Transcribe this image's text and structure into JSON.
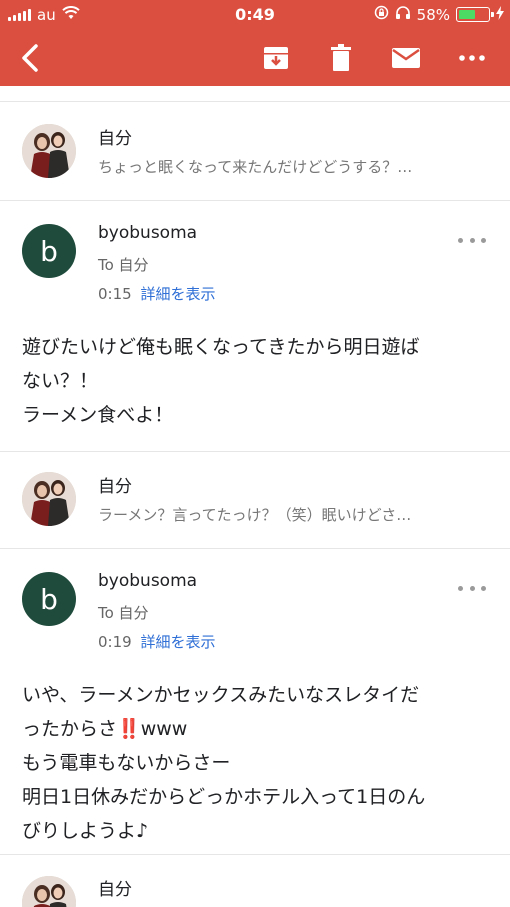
{
  "status": {
    "carrier": "au",
    "time": "0:49",
    "battery_percent_text": "58%",
    "battery_level": 0.58,
    "colors": {
      "battery_fill": "#4cd964"
    }
  },
  "toolbar": {
    "back_icon": "chevron-left-icon",
    "archive_icon": "archive-icon",
    "delete_icon": "trash-icon",
    "mark_unread_icon": "mail-icon",
    "more_icon": "more-horizontal-icon",
    "color": "#db4f40"
  },
  "thread": {
    "messages": [
      {
        "collapsed": true,
        "sender": "自分",
        "snippet": "ちょっと眠くなって来たんだけどどうする？…"
      },
      {
        "collapsed": false,
        "sender": "byobusoma",
        "avatar_letter": "b",
        "to": "To 自分",
        "time": "0:15",
        "details_link": "詳細を表示",
        "body": [
          "遊びたいけど俺も眠くなってきたから明日遊ば",
          "ない？！",
          "",
          "ラーメン食べよ！"
        ]
      },
      {
        "collapsed": true,
        "sender": "自分",
        "snippet": "ラーメン？言ってたっけ？（笑）眠いけどさ…"
      },
      {
        "collapsed": false,
        "sender": "byobusoma",
        "avatar_letter": "b",
        "to": "To 自分",
        "time": "0:19",
        "details_link": "詳細を表示",
        "body_line1": "いや、ラーメンかセックスみたいなスレタイだ",
        "body_line2_pre": "ったからさ",
        "body_line2_emoji": "‼️",
        "body_line2_post": "www",
        "body_rest": [
          "",
          "もう電車もないからさー",
          "明日1日休みだからどっかホテル入って1日のん",
          "びりしようよ♪"
        ]
      },
      {
        "collapsed": true,
        "sender": "自分"
      }
    ]
  }
}
